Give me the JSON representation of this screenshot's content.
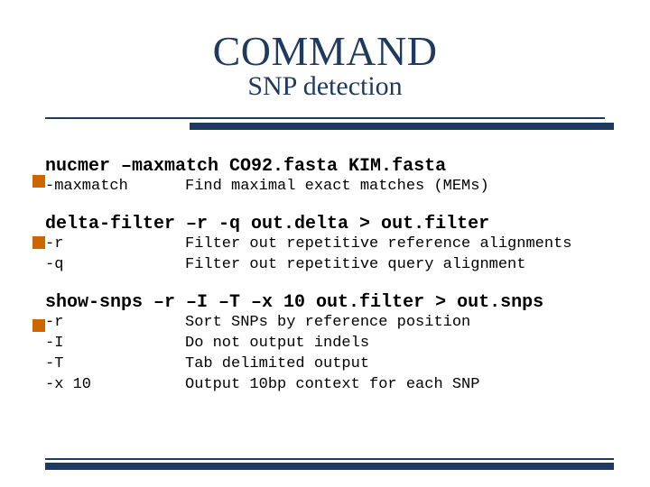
{
  "header": {
    "title": "COMMAND",
    "subtitle": "SNP detection"
  },
  "blocks": [
    {
      "command": "nucmer –maxmatch CO92.fasta KIM.fasta",
      "options": [
        {
          "flag": "-maxmatch",
          "desc": "Find maximal exact matches (MEMs)"
        }
      ]
    },
    {
      "command": "delta-filter –r -q out.delta > out.filter",
      "options": [
        {
          "flag": "-r",
          "desc": "Filter out repetitive reference alignments"
        },
        {
          "flag": "-q",
          "desc": "Filter out repetitive query alignment"
        }
      ]
    },
    {
      "command": "show-snps –r –I –T –x 10 out.filter > out.snps",
      "options": [
        {
          "flag": "-r",
          "desc": "Sort SNPs by reference position"
        },
        {
          "flag": "-I",
          "desc": "Do not output indels"
        },
        {
          "flag": "-T",
          "desc": "Tab delimited output"
        },
        {
          "flag": "-x 10",
          "desc": "Output 10bp context for each SNP"
        }
      ]
    }
  ]
}
